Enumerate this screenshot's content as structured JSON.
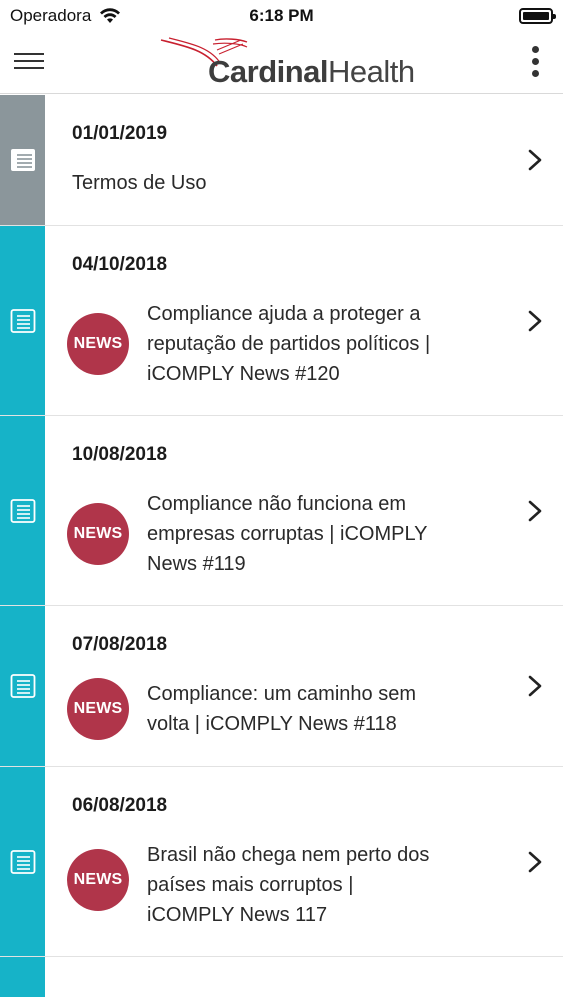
{
  "status_bar": {
    "carrier": "Operadora",
    "time": "6:18 PM"
  },
  "header": {
    "logo_text_bold": "Cardinal",
    "logo_text_regular": "Health"
  },
  "colors": {
    "accent": "#16b3c8",
    "read_stripe": "#8b969b",
    "news_badge": "#b0354a"
  },
  "items": [
    {
      "date": "01/01/2019",
      "title": "Termos de Uso",
      "badge": "",
      "icon": "document-icon"
    },
    {
      "date": "04/10/2018",
      "title_lines": [
        "Compliance ajuda a proteger a",
        "reputação de partidos políticos |",
        "iCOMPLY News #120"
      ],
      "badge": "NEWS",
      "icon": "document-icon"
    },
    {
      "date": "10/08/2018",
      "title_lines": [
        "Compliance não funciona em",
        "empresas corruptas | iCOMPLY",
        "News #119"
      ],
      "badge": "NEWS",
      "icon": "document-icon"
    },
    {
      "date": "07/08/2018",
      "title_lines": [
        "Compliance: um caminho sem",
        "volta | iCOMPLY News #118"
      ],
      "badge": "NEWS",
      "icon": "document-icon"
    },
    {
      "date": "06/08/2018",
      "title_lines": [
        "Brasil não chega nem perto dos",
        "países mais corruptos |",
        "iCOMPLY News 117"
      ],
      "badge": "NEWS",
      "icon": "document-icon"
    }
  ]
}
